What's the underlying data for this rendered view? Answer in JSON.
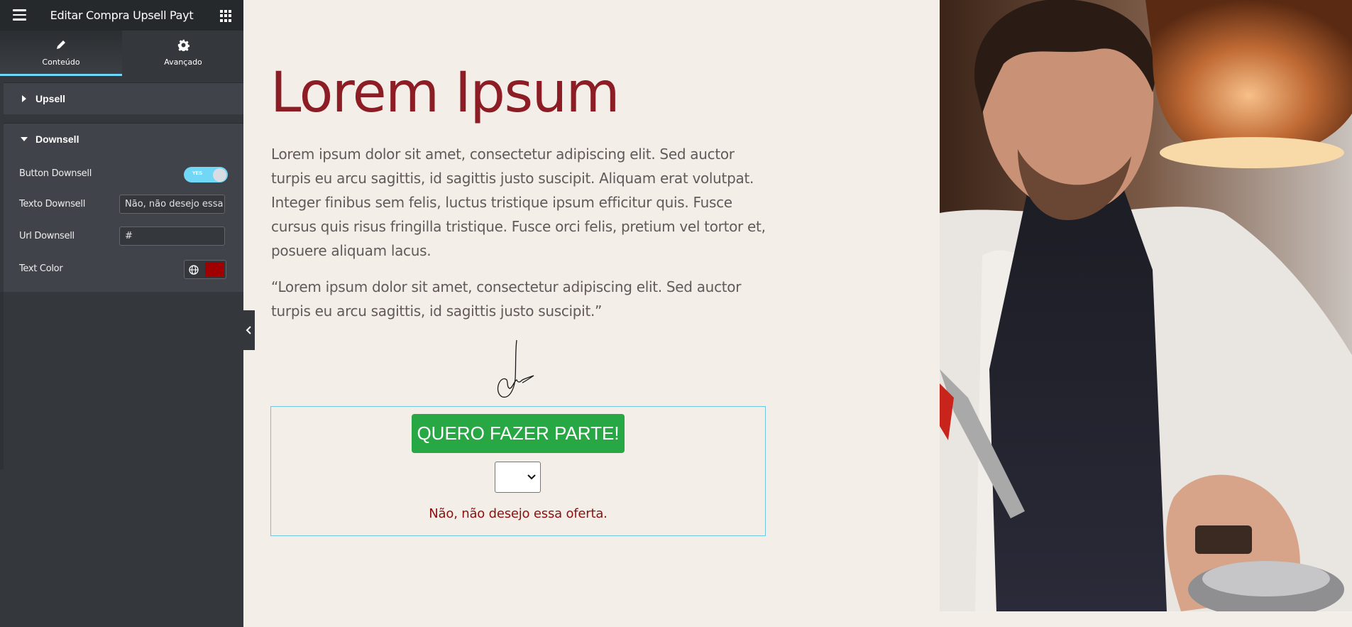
{
  "panel": {
    "title": "Editar Compra Upsell Payt",
    "tabs": [
      {
        "label": "Conteúdo",
        "icon": "pencil-icon"
      },
      {
        "label": "Avançado",
        "icon": "gear-icon"
      }
    ],
    "sections": [
      {
        "title": "Upsell",
        "expanded": false
      },
      {
        "title": "Downsell",
        "expanded": true
      }
    ],
    "controls": {
      "button_downsell_label": "Button Downsell",
      "toggle_text": "YES",
      "toggle_on": true,
      "texto_downsell_label": "Texto Downsell",
      "texto_downsell_value": "Não, não desejo essa oferta.",
      "url_downsell_label": "Url Downsell",
      "url_downsell_value": "#",
      "text_color_label": "Text Color",
      "text_color_value": "#a10000"
    }
  },
  "content": {
    "heading": "Lorem Ipsum",
    "paragraph": "Lorem ipsum dolor sit amet, consectetur adipiscing elit. Sed auctor turpis eu arcu sagittis, id sagittis justo suscipit. Aliquam erat volutpat. Integer finibus sem felis, luctus tristique ipsum efficitur quis. Fusce cursus quis risus fringilla tristique. Fusce orci felis, pretium vel tortor et, posuere aliquam lacus.",
    "quote": "“Lorem ipsum dolor sit amet, consectetur adipiscing elit. Sed auctor turpis eu arcu sagittis, id sagittis justo suscipit.”",
    "cta_button": "QUERO FAZER PARTE!",
    "downsell_link": "Não, não desejo essa oferta."
  },
  "colors": {
    "heading": "#8c1d24",
    "cta": "#28a745",
    "downsell": "#8c1010",
    "panel_accent": "#71d7f7"
  }
}
